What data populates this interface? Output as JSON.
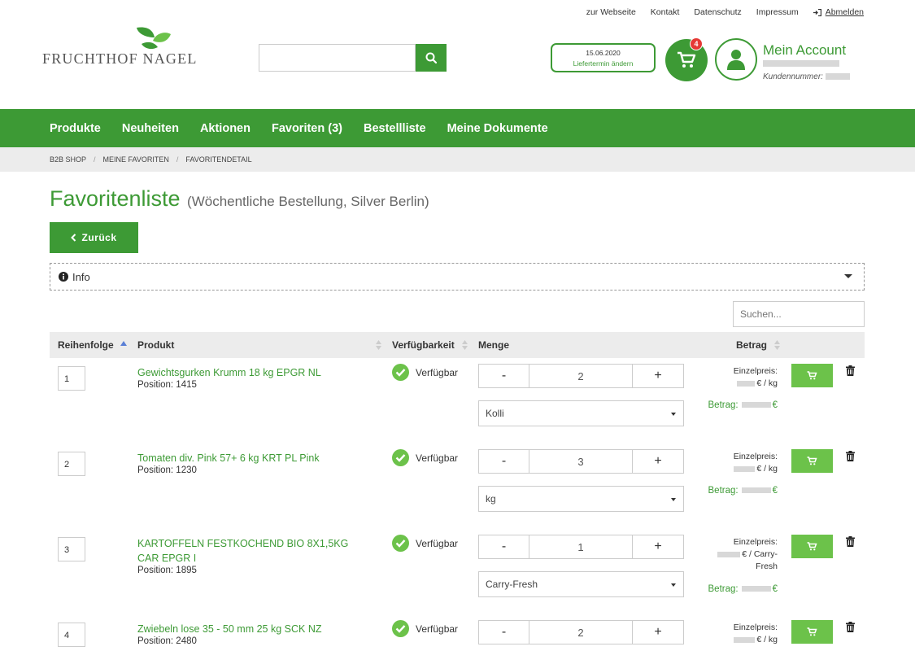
{
  "toplinks": {
    "website": "zur Webseite",
    "contact": "Kontakt",
    "privacy": "Datenschutz",
    "imprint": "Impressum",
    "logout": "Abmelden"
  },
  "logo": {
    "text": "FRUCHTHOF NAGEL"
  },
  "search": {
    "value": ""
  },
  "delivery": {
    "date": "15.06.2020",
    "change": "Liefertermin ändern"
  },
  "cart": {
    "count": "4"
  },
  "account": {
    "title": "Mein Account",
    "customer_label": "Kundennummer:"
  },
  "nav": {
    "products": "Produkte",
    "news": "Neuheiten",
    "actions": "Aktionen",
    "favorites": "Favoriten (3)",
    "orderlist": "Bestellliste",
    "documents": "Meine Dokumente"
  },
  "breadcrumb": {
    "shop": "B2B SHOP",
    "favorites": "MEINE FAVORITEN",
    "detail": "FAVORITENDETAIL"
  },
  "page": {
    "title": "Favoritenliste",
    "subtitle": "(Wöchentliche Bestellung, Silver Berlin)",
    "back": "Zurück",
    "info": "Info",
    "table_search_placeholder": "Suchen..."
  },
  "table": {
    "headers": {
      "order": "Reihenfolge",
      "product": "Produkt",
      "availability": "Verfügbarkeit",
      "quantity": "Menge",
      "amount": "Betrag"
    },
    "unit_price_label": "Einzelpreis:",
    "total_label": "Betrag:",
    "rows": [
      {
        "order": "1",
        "name": "Gewichtsgurken Krumm 18 kg EPGR NL",
        "position": "Position: 1415",
        "availability": "Verfügbar",
        "minus": "-",
        "qty": "2",
        "plus": "+",
        "unit": "Kolli",
        "price_unit": "€ / kg",
        "price_unit_2": ""
      },
      {
        "order": "2",
        "name": "Tomaten div. Pink 57+ 6 kg KRT PL Pink",
        "position": "Position: 1230",
        "availability": "Verfügbar",
        "minus": "-",
        "qty": "3",
        "plus": "+",
        "unit": "kg",
        "price_unit": "€ / kg",
        "price_unit_2": ""
      },
      {
        "order": "3",
        "name": "KARTOFFELN FESTKOCHEND BIO 8X1,5KG CAR EPGR I",
        "position": "Position: 1895",
        "availability": "Verfügbar",
        "minus": "-",
        "qty": "1",
        "plus": "+",
        "unit": "Carry-Fresh",
        "price_unit": "€ / Carry-",
        "price_unit_2": "Fresh"
      },
      {
        "order": "4",
        "name": "Zwiebeln lose 35 - 50 mm 25 kg SCK NZ",
        "position": "Position: 2480",
        "availability": "Verfügbar",
        "minus": "-",
        "qty": "2",
        "plus": "+",
        "unit": "",
        "price_unit": "€ / kg",
        "price_unit_2": ""
      }
    ]
  }
}
